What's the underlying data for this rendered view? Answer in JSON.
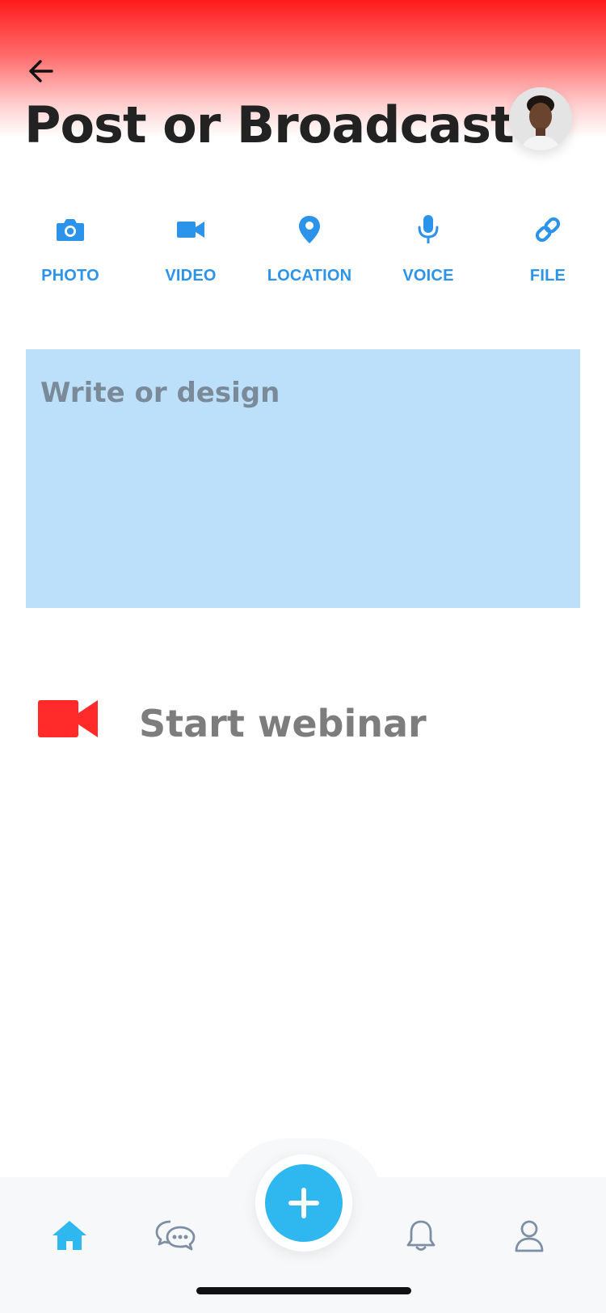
{
  "header": {
    "title": "Post or Broadcast",
    "back_icon": "arrow-left-icon",
    "avatar_icon": "user-avatar"
  },
  "attachments": [
    {
      "label": "PHOTO",
      "icon": "camera-icon"
    },
    {
      "label": "VIDEO",
      "icon": "video-camera-icon"
    },
    {
      "label": "LOCATION",
      "icon": "location-pin-icon"
    },
    {
      "label": "VOICE",
      "icon": "microphone-icon"
    },
    {
      "label": "FILE",
      "icon": "link-icon"
    }
  ],
  "editor": {
    "placeholder": "Write or design"
  },
  "webinar": {
    "label": "Start webinar",
    "icon": "video-camera-icon"
  },
  "bottom_nav": {
    "items": [
      {
        "icon": "home-icon",
        "active": true
      },
      {
        "icon": "chat-bubbles-icon",
        "active": false
      },
      {
        "icon": "plus-icon",
        "active": false
      },
      {
        "icon": "bell-icon",
        "active": false
      },
      {
        "icon": "user-icon",
        "active": false
      }
    ]
  },
  "colors": {
    "accent_blue": "#2b93e9",
    "fab_blue": "#2fb8ef",
    "header_red": "#ff1b1b",
    "webinar_red": "#ff2a2a",
    "editor_bg": "#bcdffa"
  }
}
